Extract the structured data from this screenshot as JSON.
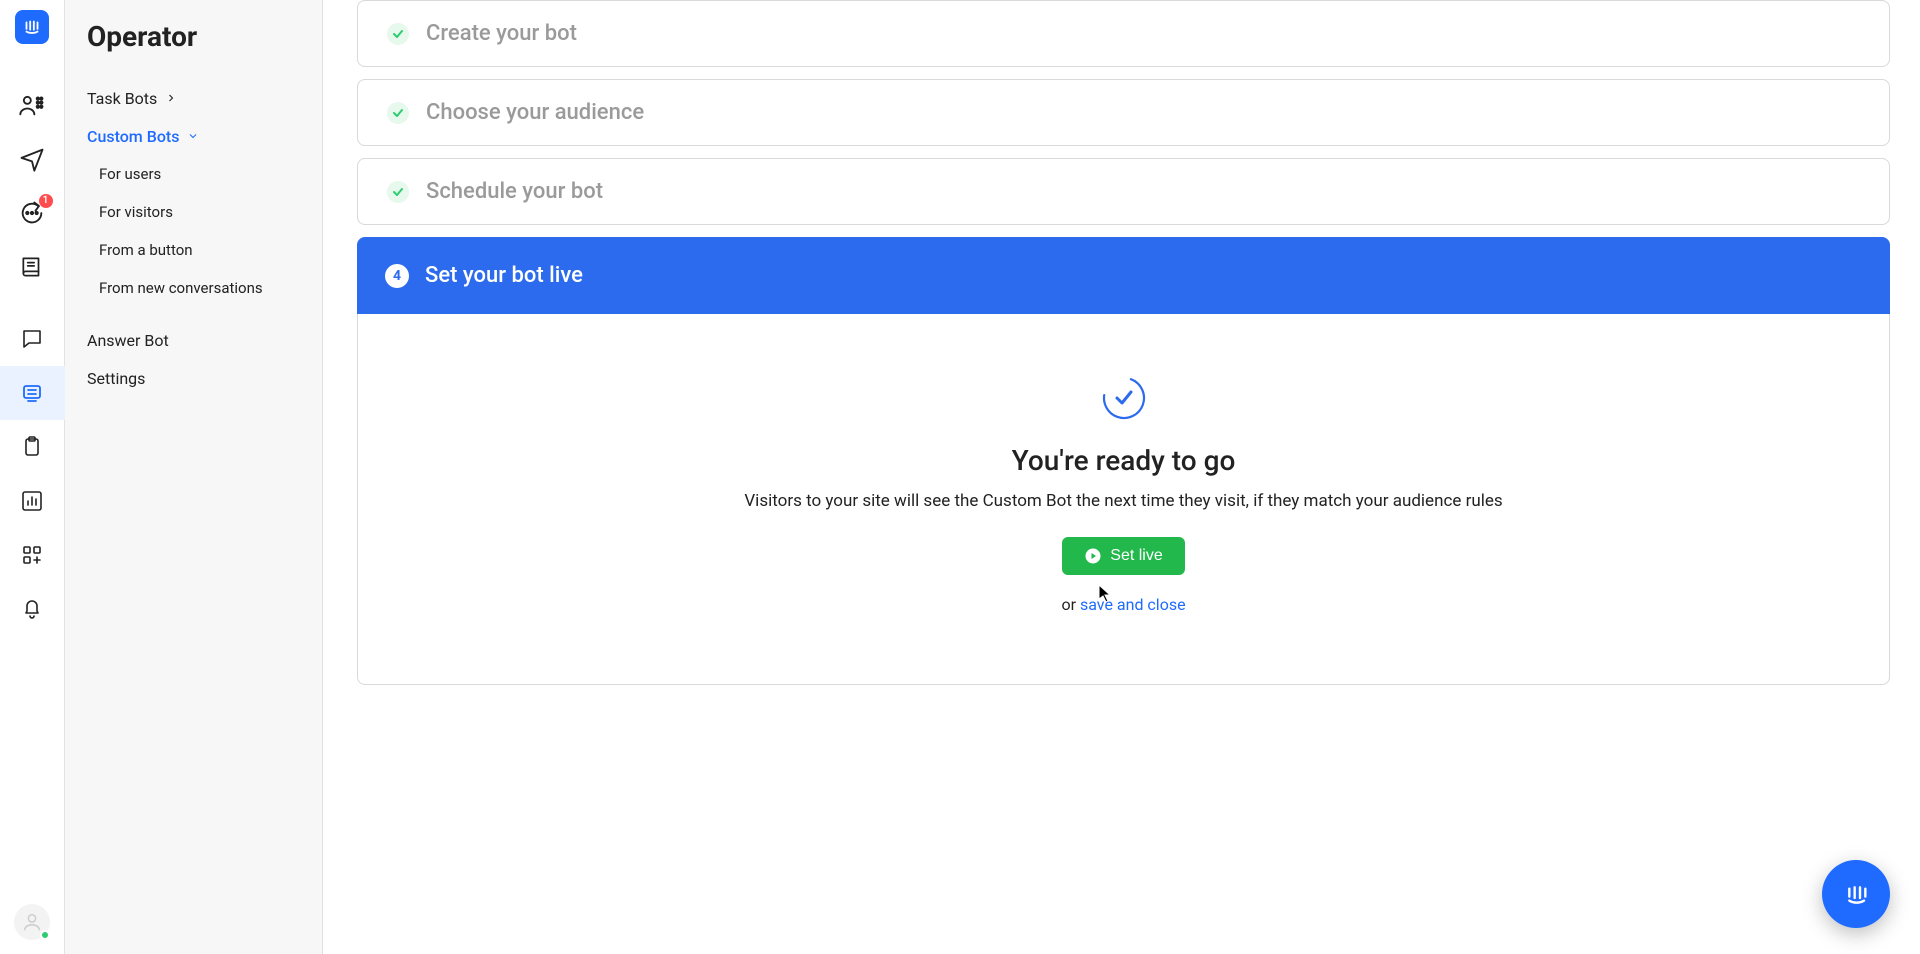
{
  "rail": {
    "inbox_badge": "1"
  },
  "sidebar": {
    "title": "Operator",
    "task_bots": "Task Bots",
    "custom_bots": "Custom Bots",
    "custom_sub": [
      "For users",
      "For visitors",
      "From a button",
      "From new conversations"
    ],
    "answer_bot": "Answer Bot",
    "settings": "Settings"
  },
  "steps": [
    {
      "title": "Create your bot",
      "done": true
    },
    {
      "title": "Choose your audience",
      "done": true
    },
    {
      "title": "Schedule your bot",
      "done": true
    }
  ],
  "active_step": {
    "number": "4",
    "title": "Set your bot live",
    "ready_title": "You're ready to go",
    "ready_sub": "Visitors to your site will see the Custom Bot the next time they visit, if they match your audience rules",
    "set_live_label": "Set live",
    "or_text": "or ",
    "save_close": "save and close"
  }
}
